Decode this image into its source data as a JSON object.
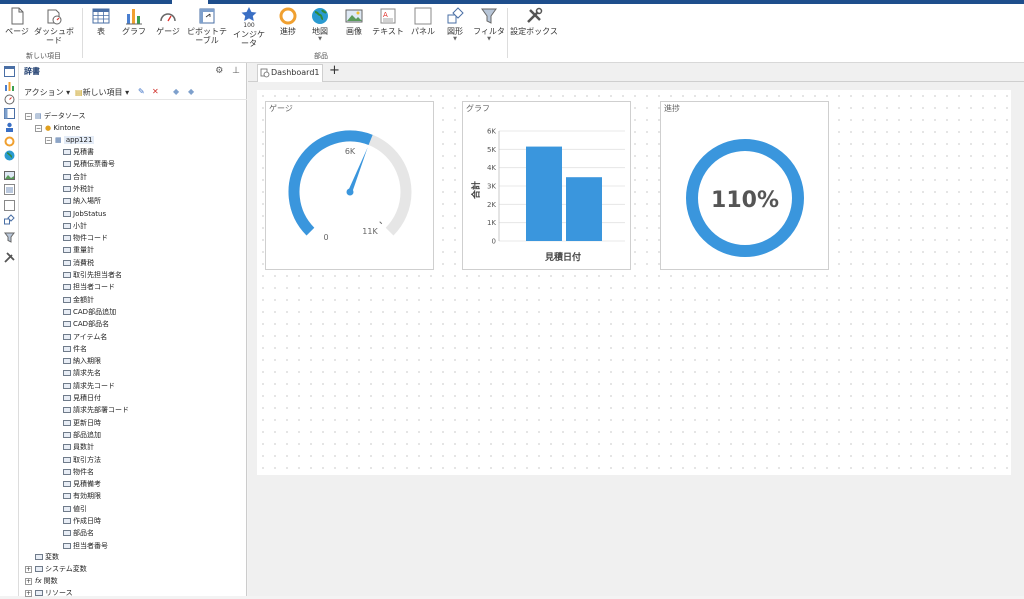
{
  "ribbon": {
    "new_items_group": "新しい項目",
    "parts_group": "部品",
    "buttons": {
      "page": "ページ",
      "dashboard": "ダッシュボード",
      "table": "表",
      "chart": "グラフ",
      "gauge": "ゲージ",
      "pivot": "ピボットテーブル",
      "indicator": "インジケータ",
      "progress": "進捗",
      "map": "地図",
      "image": "画像",
      "text": "テキスト",
      "panel": "パネル",
      "shape": "図形",
      "filter": "フィルタ",
      "settings": "設定ボックス"
    },
    "indicator_value": "100"
  },
  "dictionary": {
    "title": "辞書",
    "actions": "アクション",
    "new_item": "新しい項目",
    "tree": {
      "datasource": "データソース",
      "kintone": "Kintone",
      "app": "app121",
      "fields": [
        "見積書",
        "見積伝票番号",
        "合計",
        "外税計",
        "納入場所",
        "JobStatus",
        "小計",
        "物件コード",
        "重量計",
        "消費税",
        "取引先担当者名",
        "担当者コード",
        "金額計",
        "CAD部品追加",
        "CAD部品名",
        "アイテム名",
        "件名",
        "納入期限",
        "請求先名",
        "請求先コード",
        "見積日付",
        "請求先部署コード",
        "更新日時",
        "部品追加",
        "員数計",
        "取引方法",
        "物件名",
        "見積備考",
        "有効期限",
        "値引",
        "作成日時",
        "部品名",
        "担当者番号"
      ],
      "variables": "変数",
      "system_variables": "システム変数",
      "functions": "関数",
      "resources": "リソース"
    }
  },
  "workspace": {
    "tab_label": "Dashboard1",
    "gauge": {
      "title": "ゲージ",
      "min_label": "0",
      "mid_label": "6K",
      "max_label": "11K",
      "value_fraction": 0.58,
      "max_fraction_label": "11K"
    },
    "chart": {
      "title": "グラフ"
    },
    "progress": {
      "title": "進捗",
      "value_label": "110%"
    }
  },
  "chart_data": {
    "type": "bar",
    "categories": [
      "",
      ""
    ],
    "values": [
      5150,
      3480
    ],
    "xlabel": "見積日付",
    "ylabel": "合計",
    "ylim": [
      0,
      6000
    ],
    "yticks": [
      "0",
      "1K",
      "2K",
      "3K",
      "4K",
      "5K",
      "6K"
    ],
    "color": "#3a96dd",
    "grid": true
  },
  "colors": {
    "accent": "#3a96dd",
    "brand": "#1e4e8c"
  }
}
